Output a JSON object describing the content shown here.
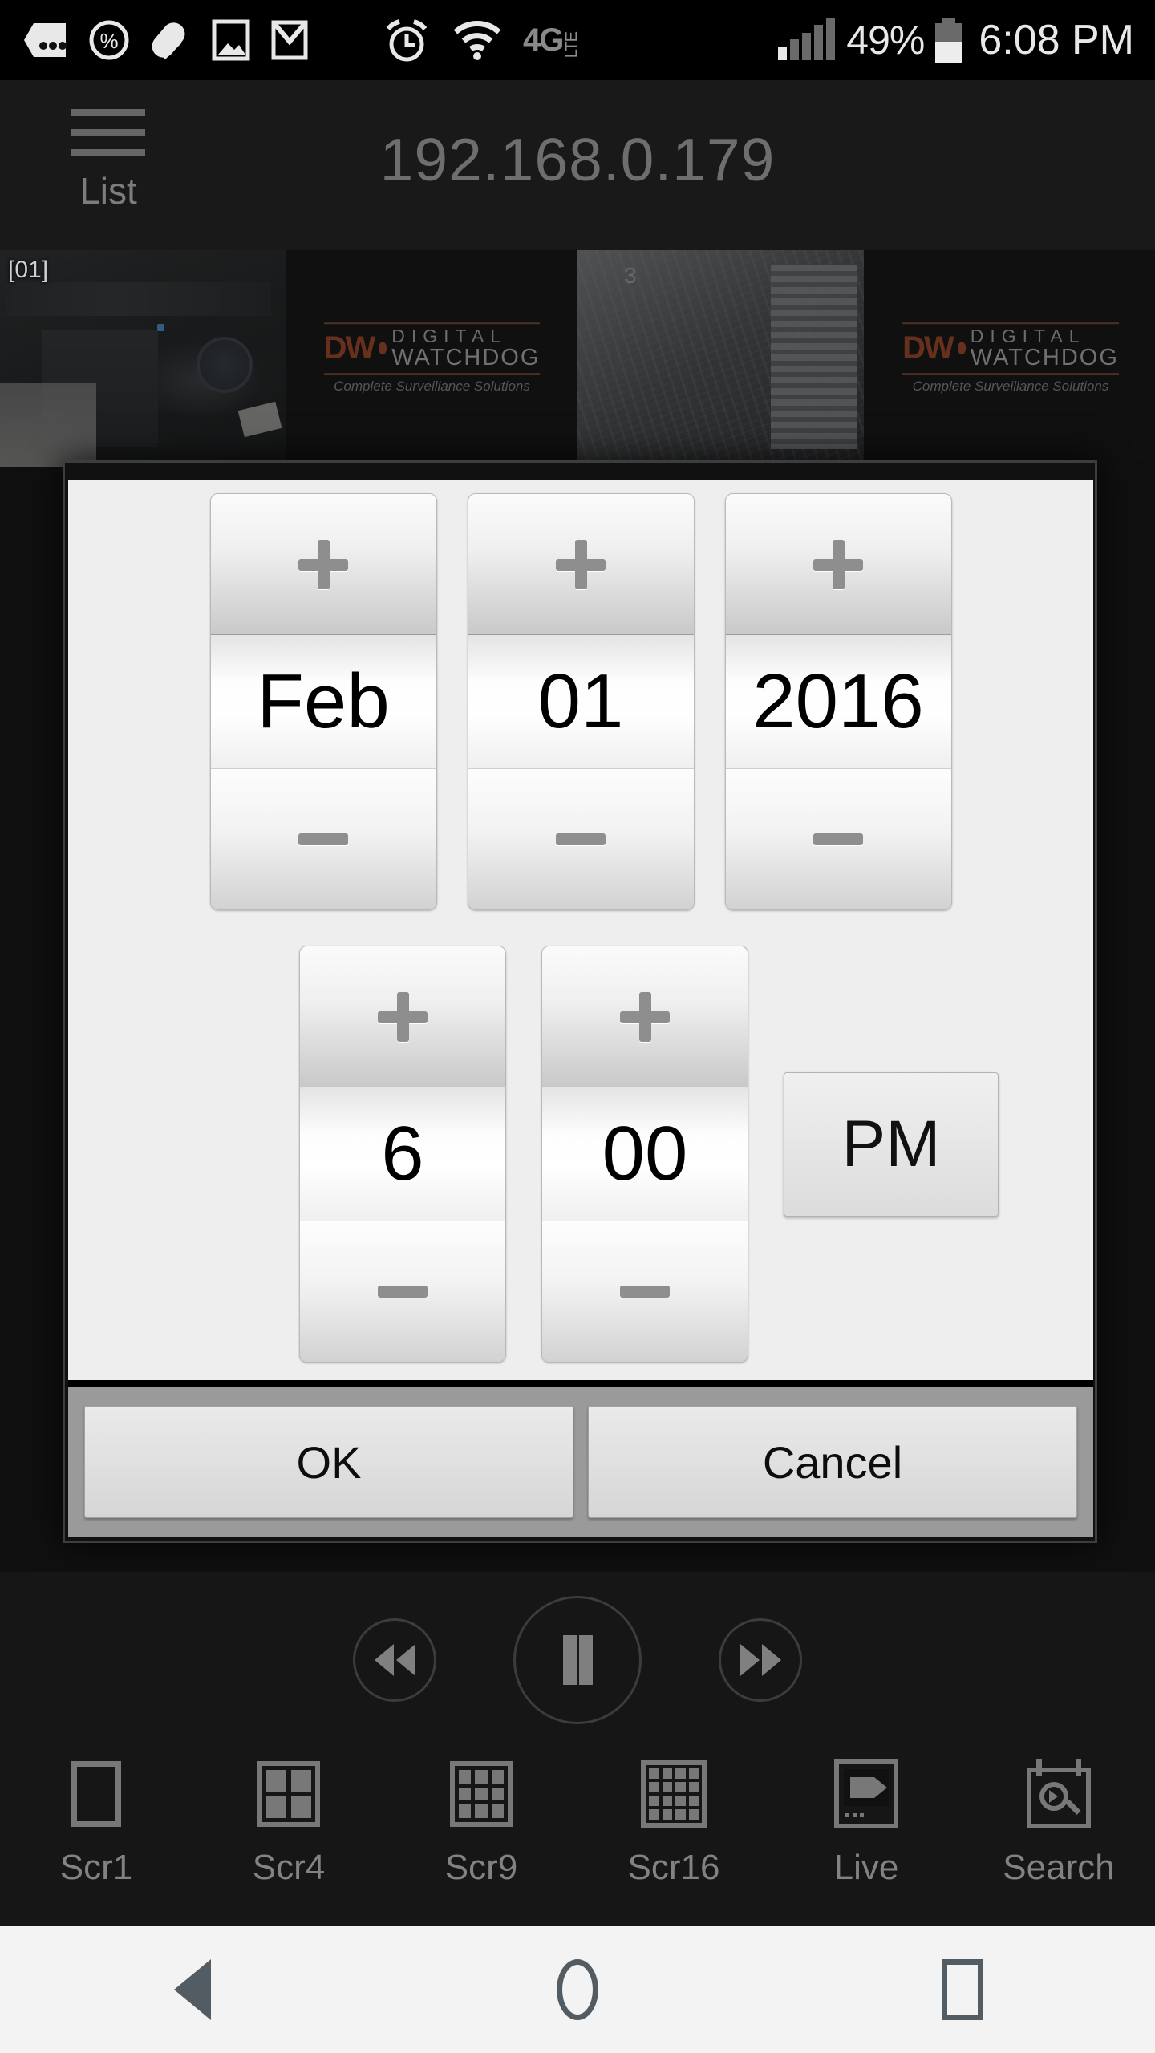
{
  "status_bar": {
    "icons": [
      "chat-dots-icon",
      "percent-circle-icon",
      "pill-icon",
      "photo-icon",
      "gmail-icon",
      "alarm-clock-icon",
      "wifi-icon"
    ],
    "network_label": "4G",
    "network_sub": "LTE",
    "battery_percent": "49%",
    "time": "6:08 PM"
  },
  "app_bar": {
    "menu_label": "List",
    "title": "192.168.0.179"
  },
  "video_grid": {
    "camera_label": "[01]",
    "logo": {
      "mark": "DW",
      "line1": "DIGITAL",
      "line2": "WATCHDOG",
      "tagline": "Complete Surveillance Solutions",
      "accent_color": "#c2481b"
    },
    "tiles": [
      {
        "label": "[01]",
        "type": "video"
      },
      {
        "label": "",
        "type": "logo"
      },
      {
        "label": "",
        "type": "video"
      },
      {
        "label": "",
        "type": "logo"
      }
    ]
  },
  "dialog": {
    "date": {
      "month": {
        "value": "Feb",
        "plus": "+",
        "minus": "–"
      },
      "day": {
        "value": "01",
        "plus": "+",
        "minus": "–"
      },
      "year": {
        "value": "2016",
        "plus": "+",
        "minus": "–"
      }
    },
    "time": {
      "hour": {
        "value": "6",
        "plus": "+",
        "minus": "–"
      },
      "minute": {
        "value": "00",
        "plus": "+",
        "minus": "–"
      },
      "meridiem": "PM"
    },
    "ok_label": "OK",
    "cancel_label": "Cancel"
  },
  "playback": {
    "rewind": "rewind-icon",
    "pause": "pause-icon",
    "forward": "fast-forward-icon"
  },
  "tab_bar": {
    "tabs": [
      {
        "label": "Scr1",
        "icon": "screen-1-icon"
      },
      {
        "label": "Scr4",
        "icon": "screen-4-grid-icon"
      },
      {
        "label": "Scr9",
        "icon": "screen-9-grid-icon"
      },
      {
        "label": "Scr16",
        "icon": "screen-16-grid-icon"
      },
      {
        "label": "Live",
        "icon": "live-camera-icon"
      },
      {
        "label": "Search",
        "icon": "calendar-search-icon"
      }
    ]
  },
  "nav_bar": {
    "back": "back-icon",
    "home": "home-icon",
    "recents": "recents-icon"
  }
}
